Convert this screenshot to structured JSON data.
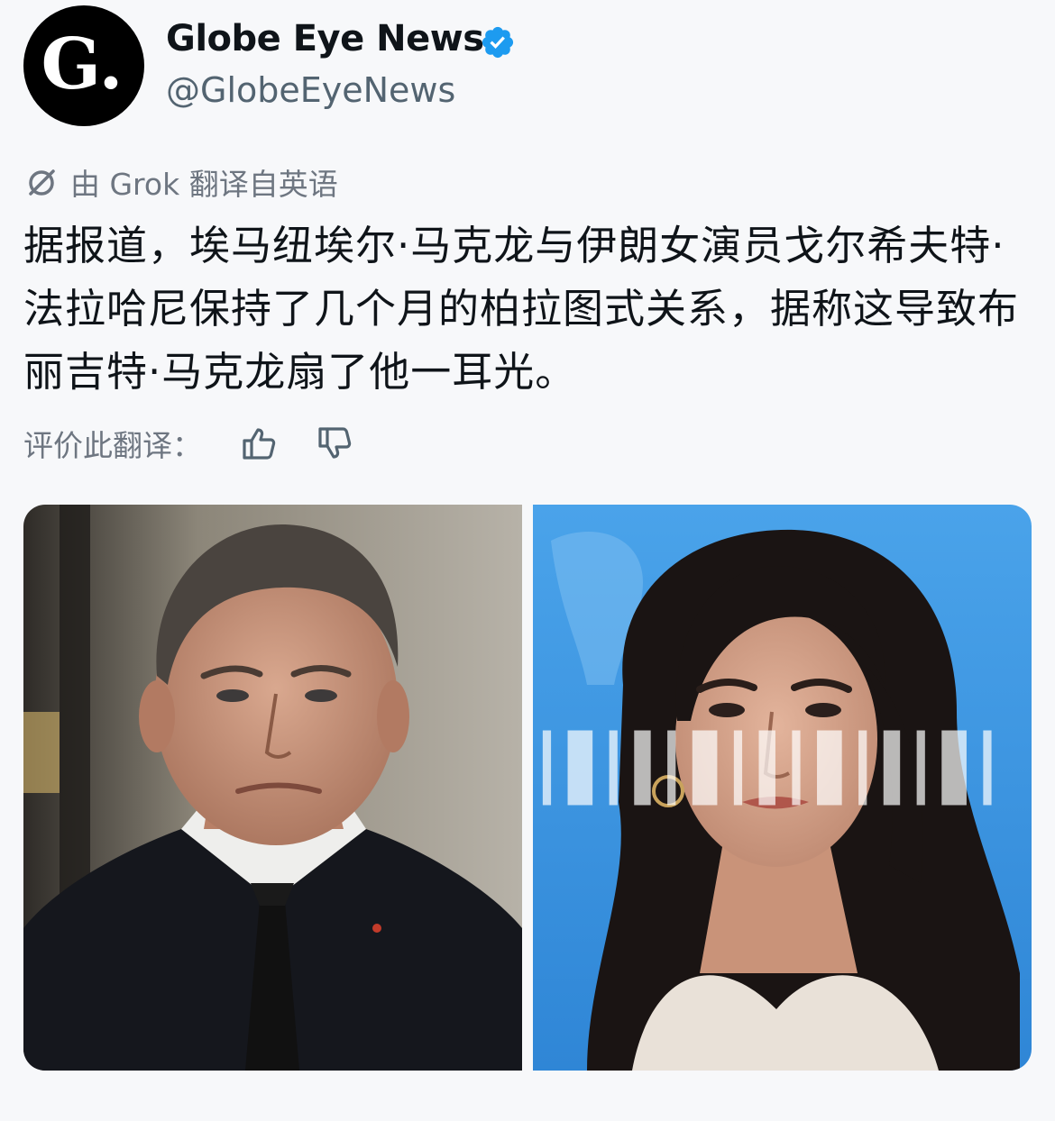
{
  "account": {
    "avatar_letter": "G.",
    "display_name": "Globe Eye News",
    "handle": "@GlobeEyeNews",
    "verified": true
  },
  "translation": {
    "note": "由 Grok 翻译自英语",
    "icon": "translate-slash-icon"
  },
  "post": {
    "text": "据报道，埃马纽埃尔·马克龙与伊朗女演员戈尔希夫特·法拉哈尼保持了几个月的柏拉图式关系，据称这导致布丽吉特·马克龙扇了他一耳光。"
  },
  "rating": {
    "label": "评价此翻译：",
    "up_icon": "thumbs-up-icon",
    "down_icon": "thumbs-down-icon"
  },
  "media": {
    "count": 2
  },
  "colors": {
    "verified": "#1d9bf0",
    "muted": "#6e7681",
    "text": "#0f1419",
    "background": "#f7f8fa",
    "right_photo_bg": "#3f9ae3"
  }
}
